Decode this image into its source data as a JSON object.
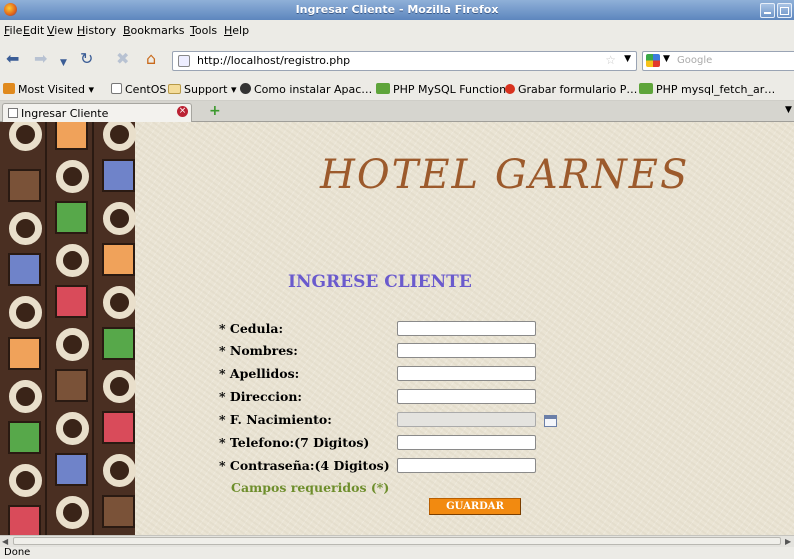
{
  "window": {
    "title": "Ingresar Cliente - Mozilla Firefox"
  },
  "menu": [
    "File",
    "Edit",
    "View",
    "History",
    "Bookmarks",
    "Tools",
    "Help"
  ],
  "nav": {
    "url": "http://localhost/registro.php",
    "search_placeholder": "Google"
  },
  "bookmarks": [
    "Most Visited ▾",
    "CentOS",
    "Support ▾",
    "Como instalar Apac…",
    "PHP MySQL Functions",
    "Grabar formulario P…",
    "PHP mysql_fetch_ar…"
  ],
  "tab": {
    "label": "Ingresar Cliente"
  },
  "page": {
    "heading": "HOTEL GARNES",
    "form_title": "INGRESE CLIENTE",
    "fields": [
      {
        "label": "* Cedula:",
        "value": ""
      },
      {
        "label": "* Nombres:",
        "value": ""
      },
      {
        "label": "* Apellidos:",
        "value": ""
      },
      {
        "label": "* Direccion:",
        "value": ""
      },
      {
        "label": "* F. Nacimiento:",
        "value": ""
      },
      {
        "label": "* Telefono:(7 Digitos)",
        "value": ""
      },
      {
        "label": "* Contraseña:(4 Digitos)",
        "value": ""
      }
    ],
    "required_note": "Campos requeridos (*)",
    "save_label": "GUARDAR"
  },
  "status": {
    "text": "Done"
  },
  "colors": {
    "heading": "#9c5a2c",
    "form_title": "#6a5acd",
    "required_note": "#6e8e2c",
    "button": "#f28a10"
  },
  "icons": [
    "firefox-icon",
    "back-icon",
    "forward-icon",
    "reload-icon",
    "stop-icon",
    "home-icon",
    "calendar-icon",
    "new-tab-icon",
    "search-icon"
  ]
}
